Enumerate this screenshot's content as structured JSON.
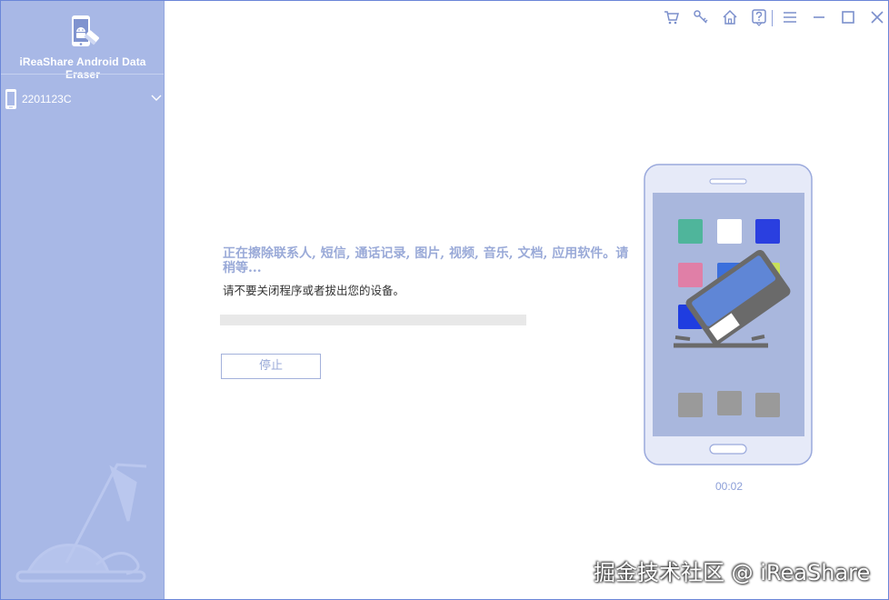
{
  "app": {
    "title": "iReaShare Android Data Eraser"
  },
  "sidebar": {
    "device": {
      "name": "2201123C"
    }
  },
  "toolbar": {
    "icons": [
      "cart-icon",
      "key-icon",
      "home-icon",
      "help-icon",
      "menu-icon",
      "minimize-icon",
      "maximize-icon",
      "close-icon"
    ]
  },
  "main": {
    "status_title": "正在擦除联系人, 短信, 通话记录, 图片, 视频, 音乐, 文档, 应用软件。请稍等...",
    "status_subtitle": "请不要关闭程序或者拔出您的设备。",
    "progress": 0,
    "stop_label": "停止",
    "timer": "00:02"
  },
  "watermark": "掘金技术社区 @ iReaShare",
  "colors": {
    "sidebar_bg": "#a8b8e6",
    "accent": "#9aaad8",
    "phone_screen": "#a9b7dd"
  }
}
